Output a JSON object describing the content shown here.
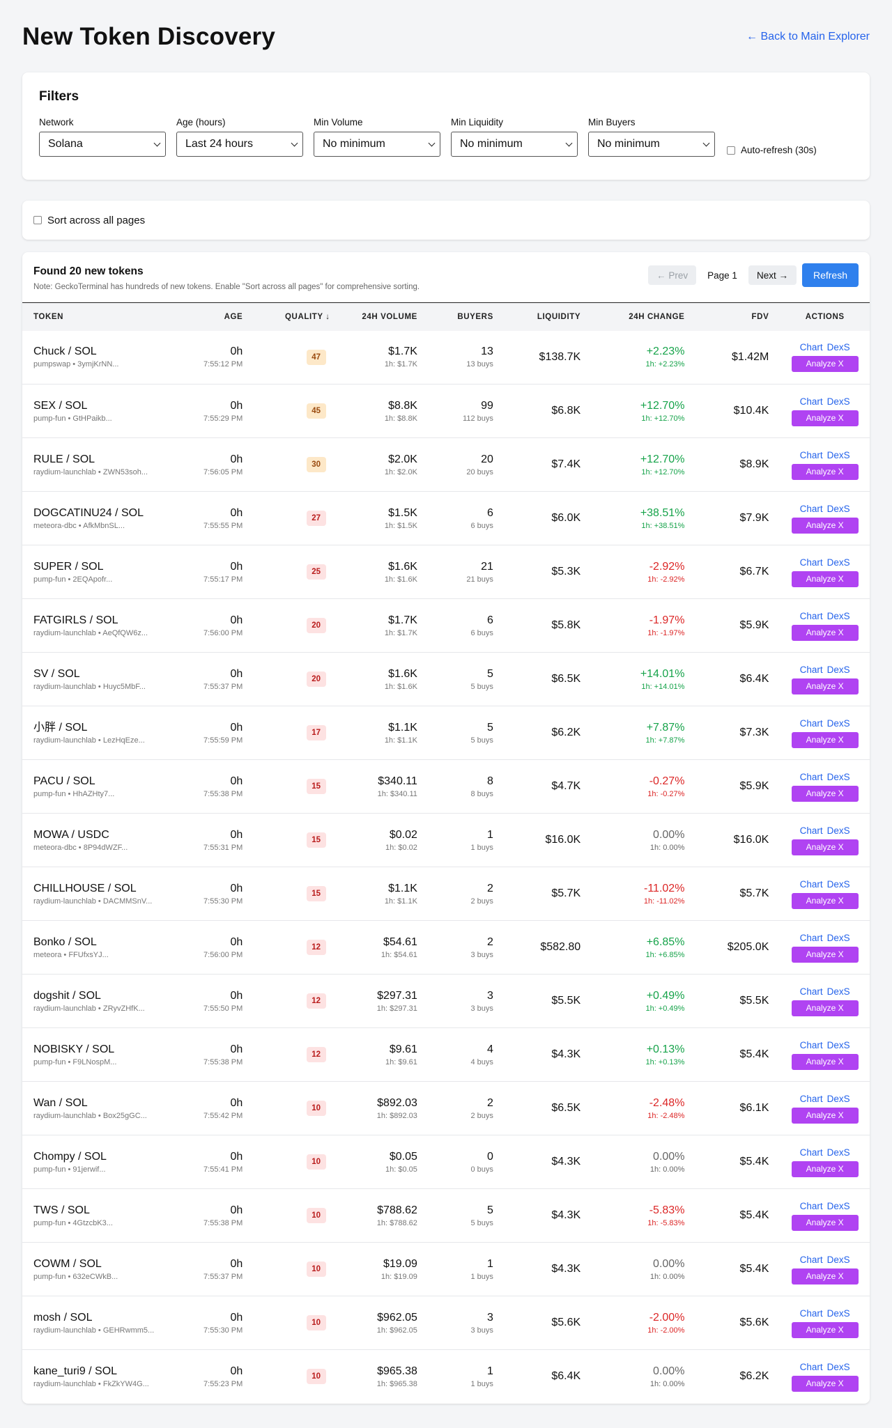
{
  "header": {
    "title": "New Token Discovery",
    "back_link": "← Back to Main Explorer"
  },
  "filters": {
    "title": "Filters",
    "groups": [
      {
        "label": "Network",
        "value": "Solana"
      },
      {
        "label": "Age (hours)",
        "value": "Last 24 hours"
      },
      {
        "label": "Min Volume",
        "value": "No minimum"
      },
      {
        "label": "Min Liquidity",
        "value": "No minimum"
      },
      {
        "label": "Min Buyers",
        "value": "No minimum"
      }
    ],
    "auto_refresh_label": "Auto-refresh (30s)"
  },
  "sort_all": {
    "label": "Sort across all pages"
  },
  "results": {
    "title": "Found 20 new tokens",
    "note": "Note: GeckoTerminal has hundreds of new tokens. Enable \"Sort across all pages\" for comprehensive sorting.",
    "prev": "← Prev",
    "page": "Page 1",
    "next": "Next →",
    "refresh": "Refresh"
  },
  "columns": {
    "token": "TOKEN",
    "age": "AGE",
    "quality": "QUALITY ↓",
    "volume": "24H VOLUME",
    "buyers": "BUYERS",
    "liquidity": "LIQUIDITY",
    "change": "24H CHANGE",
    "fdv": "FDV",
    "actions": "ACTIONS"
  },
  "action_labels": {
    "chart": "Chart",
    "dexs": "DexS",
    "analyze": "Analyze X"
  },
  "colors": {
    "quality_high_bg": "#fde8c8",
    "quality_high_fg": "#9a4a0f",
    "quality_low_bg": "#fde2e2",
    "quality_low_fg": "#b91c1c",
    "positive": "#16a34a",
    "negative": "#dc2626",
    "accent": "#2f80ed",
    "analyze": "#b043f2"
  },
  "rows": [
    {
      "token": "Chuck / SOL",
      "meta": "pumpswap • 3ymjKrNN...",
      "age": "0h",
      "time": "7:55:12 PM",
      "quality": "47",
      "quality_level": "high",
      "volume": "$1.7K",
      "volume_1h": "1h: $1.7K",
      "buyers": "13",
      "buys": "13 buys",
      "liquidity": "$138.7K",
      "change": "+2.23%",
      "change_1h": "1h: +2.23%",
      "dir": "pos",
      "fdv": "$1.42M"
    },
    {
      "token": "SEX / SOL",
      "meta": "pump-fun • GtHPaikb...",
      "age": "0h",
      "time": "7:55:29 PM",
      "quality": "45",
      "quality_level": "high",
      "volume": "$8.8K",
      "volume_1h": "1h: $8.8K",
      "buyers": "99",
      "buys": "112 buys",
      "liquidity": "$6.8K",
      "change": "+12.70%",
      "change_1h": "1h: +12.70%",
      "dir": "pos",
      "fdv": "$10.4K"
    },
    {
      "token": "RULE / SOL",
      "meta": "raydium-launchlab • ZWN53soh...",
      "age": "0h",
      "time": "7:56:05 PM",
      "quality": "30",
      "quality_level": "high",
      "volume": "$2.0K",
      "volume_1h": "1h: $2.0K",
      "buyers": "20",
      "buys": "20 buys",
      "liquidity": "$7.4K",
      "change": "+12.70%",
      "change_1h": "1h: +12.70%",
      "dir": "pos",
      "fdv": "$8.9K"
    },
    {
      "token": "DOGCATINU24 / SOL",
      "meta": "meteora-dbc • AfkMbnSL...",
      "age": "0h",
      "time": "7:55:55 PM",
      "quality": "27",
      "quality_level": "low",
      "volume": "$1.5K",
      "volume_1h": "1h: $1.5K",
      "buyers": "6",
      "buys": "6 buys",
      "liquidity": "$6.0K",
      "change": "+38.51%",
      "change_1h": "1h: +38.51%",
      "dir": "pos",
      "fdv": "$7.9K"
    },
    {
      "token": "SUPER / SOL",
      "meta": "pump-fun • 2EQApofr...",
      "age": "0h",
      "time": "7:55:17 PM",
      "quality": "25",
      "quality_level": "low",
      "volume": "$1.6K",
      "volume_1h": "1h: $1.6K",
      "buyers": "21",
      "buys": "21 buys",
      "liquidity": "$5.3K",
      "change": "-2.92%",
      "change_1h": "1h: -2.92%",
      "dir": "neg",
      "fdv": "$6.7K"
    },
    {
      "token": "FATGIRLS / SOL",
      "meta": "raydium-launchlab • AeQfQW6z...",
      "age": "0h",
      "time": "7:56:00 PM",
      "quality": "20",
      "quality_level": "low",
      "volume": "$1.7K",
      "volume_1h": "1h: $1.7K",
      "buyers": "6",
      "buys": "6 buys",
      "liquidity": "$5.8K",
      "change": "-1.97%",
      "change_1h": "1h: -1.97%",
      "dir": "neg",
      "fdv": "$5.9K"
    },
    {
      "token": "SV / SOL",
      "meta": "raydium-launchlab • Huyc5MbF...",
      "age": "0h",
      "time": "7:55:37 PM",
      "quality": "20",
      "quality_level": "low",
      "volume": "$1.6K",
      "volume_1h": "1h: $1.6K",
      "buyers": "5",
      "buys": "5 buys",
      "liquidity": "$6.5K",
      "change": "+14.01%",
      "change_1h": "1h: +14.01%",
      "dir": "pos",
      "fdv": "$6.4K"
    },
    {
      "token": "小胖 / SOL",
      "meta": "raydium-launchlab • LezHqEze...",
      "age": "0h",
      "time": "7:55:59 PM",
      "quality": "17",
      "quality_level": "low",
      "volume": "$1.1K",
      "volume_1h": "1h: $1.1K",
      "buyers": "5",
      "buys": "5 buys",
      "liquidity": "$6.2K",
      "change": "+7.87%",
      "change_1h": "1h: +7.87%",
      "dir": "pos",
      "fdv": "$7.3K"
    },
    {
      "token": "PACU / SOL",
      "meta": "pump-fun • HhAZHty7...",
      "age": "0h",
      "time": "7:55:38 PM",
      "quality": "15",
      "quality_level": "low",
      "volume": "$340.11",
      "volume_1h": "1h: $340.11",
      "buyers": "8",
      "buys": "8 buys",
      "liquidity": "$4.7K",
      "change": "-0.27%",
      "change_1h": "1h: -0.27%",
      "dir": "neg",
      "fdv": "$5.9K"
    },
    {
      "token": "MOWA / USDC",
      "meta": "meteora-dbc • 8P94dWZF...",
      "age": "0h",
      "time": "7:55:31 PM",
      "quality": "15",
      "quality_level": "low",
      "volume": "$0.02",
      "volume_1h": "1h: $0.02",
      "buyers": "1",
      "buys": "1 buys",
      "liquidity": "$16.0K",
      "change": "0.00%",
      "change_1h": "1h: 0.00%",
      "dir": "neu",
      "fdv": "$16.0K"
    },
    {
      "token": "CHILLHOUSE / SOL",
      "meta": "raydium-launchlab • DACMMSnV...",
      "age": "0h",
      "time": "7:55:30 PM",
      "quality": "15",
      "quality_level": "low",
      "volume": "$1.1K",
      "volume_1h": "1h: $1.1K",
      "buyers": "2",
      "buys": "2 buys",
      "liquidity": "$5.7K",
      "change": "-11.02%",
      "change_1h": "1h: -11.02%",
      "dir": "neg",
      "fdv": "$5.7K"
    },
    {
      "token": "Bonko / SOL",
      "meta": "meteora • FFUfxsYJ...",
      "age": "0h",
      "time": "7:56:00 PM",
      "quality": "12",
      "quality_level": "low",
      "volume": "$54.61",
      "volume_1h": "1h: $54.61",
      "buyers": "2",
      "buys": "3 buys",
      "liquidity": "$582.80",
      "change": "+6.85%",
      "change_1h": "1h: +6.85%",
      "dir": "pos",
      "fdv": "$205.0K"
    },
    {
      "token": "dogshit / SOL",
      "meta": "raydium-launchlab • ZRyvZHfK...",
      "age": "0h",
      "time": "7:55:50 PM",
      "quality": "12",
      "quality_level": "low",
      "volume": "$297.31",
      "volume_1h": "1h: $297.31",
      "buyers": "3",
      "buys": "3 buys",
      "liquidity": "$5.5K",
      "change": "+0.49%",
      "change_1h": "1h: +0.49%",
      "dir": "pos",
      "fdv": "$5.5K"
    },
    {
      "token": "NOBISKY / SOL",
      "meta": "pump-fun • F9LNospM...",
      "age": "0h",
      "time": "7:55:38 PM",
      "quality": "12",
      "quality_level": "low",
      "volume": "$9.61",
      "volume_1h": "1h: $9.61",
      "buyers": "4",
      "buys": "4 buys",
      "liquidity": "$4.3K",
      "change": "+0.13%",
      "change_1h": "1h: +0.13%",
      "dir": "pos",
      "fdv": "$5.4K"
    },
    {
      "token": "Wan / SOL",
      "meta": "raydium-launchlab • Box25gGC...",
      "age": "0h",
      "time": "7:55:42 PM",
      "quality": "10",
      "quality_level": "low",
      "volume": "$892.03",
      "volume_1h": "1h: $892.03",
      "buyers": "2",
      "buys": "2 buys",
      "liquidity": "$6.5K",
      "change": "-2.48%",
      "change_1h": "1h: -2.48%",
      "dir": "neg",
      "fdv": "$6.1K"
    },
    {
      "token": "Chompy / SOL",
      "meta": "pump-fun • 91jerwif...",
      "age": "0h",
      "time": "7:55:41 PM",
      "quality": "10",
      "quality_level": "low",
      "volume": "$0.05",
      "volume_1h": "1h: $0.05",
      "buyers": "0",
      "buys": "0 buys",
      "liquidity": "$4.3K",
      "change": "0.00%",
      "change_1h": "1h: 0.00%",
      "dir": "neu",
      "fdv": "$5.4K"
    },
    {
      "token": "TWS / SOL",
      "meta": "pump-fun • 4GtzcbK3...",
      "age": "0h",
      "time": "7:55:38 PM",
      "quality": "10",
      "quality_level": "low",
      "volume": "$788.62",
      "volume_1h": "1h: $788.62",
      "buyers": "5",
      "buys": "5 buys",
      "liquidity": "$4.3K",
      "change": "-5.83%",
      "change_1h": "1h: -5.83%",
      "dir": "neg",
      "fdv": "$5.4K"
    },
    {
      "token": "COWM / SOL",
      "meta": "pump-fun • 632eCWkB...",
      "age": "0h",
      "time": "7:55:37 PM",
      "quality": "10",
      "quality_level": "low",
      "volume": "$19.09",
      "volume_1h": "1h: $19.09",
      "buyers": "1",
      "buys": "1 buys",
      "liquidity": "$4.3K",
      "change": "0.00%",
      "change_1h": "1h: 0.00%",
      "dir": "neu",
      "fdv": "$5.4K"
    },
    {
      "token": "mosh / SOL",
      "meta": "raydium-launchlab • GEHRwmm5...",
      "age": "0h",
      "time": "7:55:30 PM",
      "quality": "10",
      "quality_level": "low",
      "volume": "$962.05",
      "volume_1h": "1h: $962.05",
      "buyers": "3",
      "buys": "3 buys",
      "liquidity": "$5.6K",
      "change": "-2.00%",
      "change_1h": "1h: -2.00%",
      "dir": "neg",
      "fdv": "$5.6K"
    },
    {
      "token": "kane_turi9 / SOL",
      "meta": "raydium-launchlab • FkZkYW4G...",
      "age": "0h",
      "time": "7:55:23 PM",
      "quality": "10",
      "quality_level": "low",
      "volume": "$965.38",
      "volume_1h": "1h: $965.38",
      "buyers": "1",
      "buys": "1 buys",
      "liquidity": "$6.4K",
      "change": "0.00%",
      "change_1h": "1h: 0.00%",
      "dir": "neu",
      "fdv": "$6.2K"
    }
  ]
}
